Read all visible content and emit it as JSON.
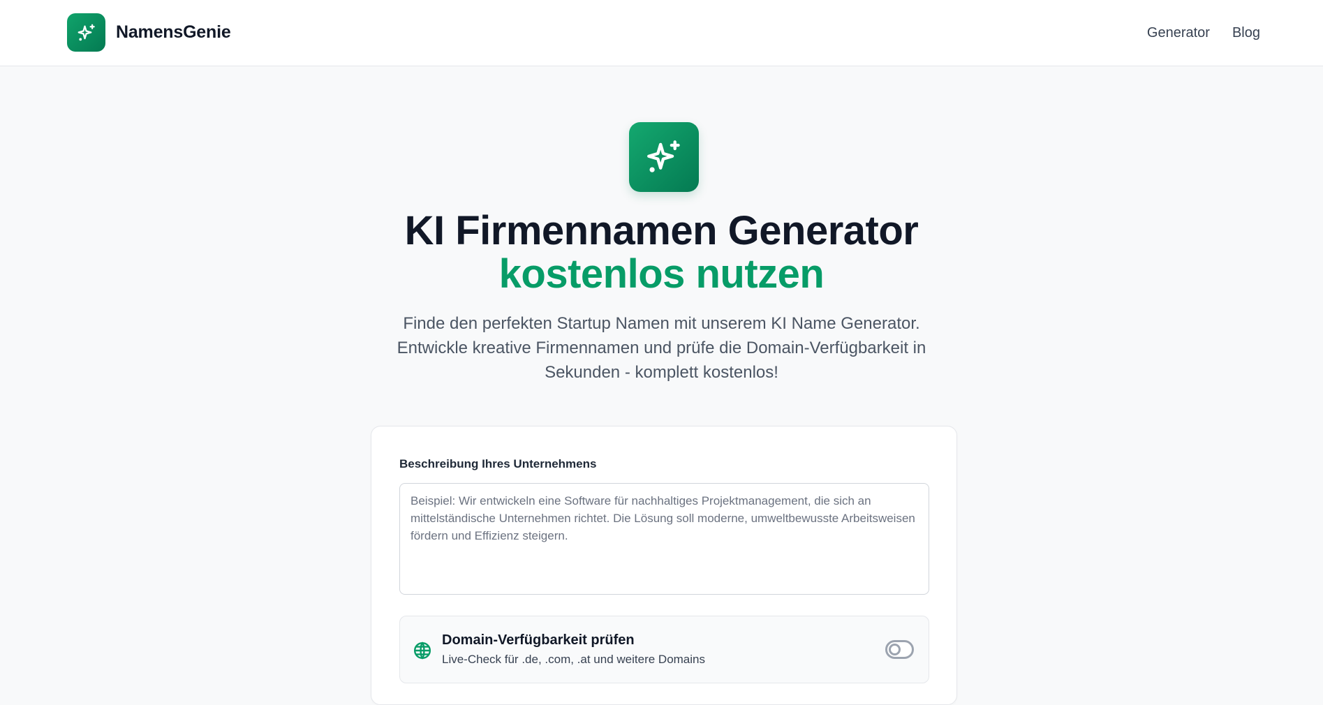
{
  "header": {
    "brand_name": "NamensGenie",
    "nav": [
      {
        "label": "Generator"
      },
      {
        "label": "Blog"
      }
    ]
  },
  "hero": {
    "icon": "sparkles-icon",
    "title_line1": "KI Firmennamen Generator",
    "title_line2": "kostenlos nutzen",
    "subtitle": "Finde den perfekten Startup Namen mit unserem KI Name Generator. Entwickle kreative Firmennamen und prüfe die Domain-Verfügbarkeit in Sekunden - komplett kostenlos!"
  },
  "form": {
    "description_label": "Beschreibung Ihres Unternehmens",
    "description_value": "",
    "description_placeholder": "Beispiel: Wir entwickeln eine Software für nachhaltiges Projektmanagement, die sich an mittelständische Unternehmen richtet. Die Lösung soll moderne, umweltbewusste Arbeitsweisen fördern und Effizienz steigern.",
    "domain_check": {
      "icon": "globe-icon",
      "title": "Domain-Verfügbarkeit prüfen",
      "subtitle": "Live-Check für .de, .com, .at und weitere Domains",
      "enabled": false
    }
  },
  "colors": {
    "accent": "#079c67",
    "accent_dark": "#047a52",
    "text_primary": "#111827",
    "text_secondary": "#4b5563",
    "background": "#f8f9fa"
  }
}
